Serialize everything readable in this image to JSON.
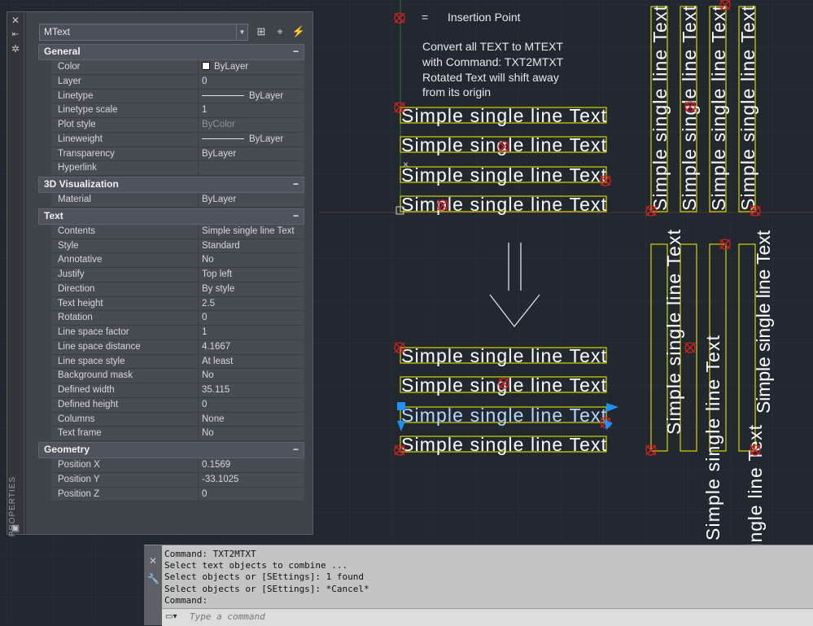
{
  "palette": {
    "close_icon": "close-icon",
    "vertical_title": "PROPERTIES",
    "object_type": "MText",
    "sections": [
      {
        "title": "General",
        "rows": [
          {
            "name": "Color",
            "value": "ByLayer",
            "icon": "swatch"
          },
          {
            "name": "Layer",
            "value": "0"
          },
          {
            "name": "Linetype",
            "value": "ByLayer",
            "icon": "line"
          },
          {
            "name": "Linetype scale",
            "value": "1"
          },
          {
            "name": "Plot style",
            "value": "ByColor",
            "dim": true
          },
          {
            "name": "Lineweight",
            "value": "ByLayer",
            "icon": "line"
          },
          {
            "name": "Transparency",
            "value": "ByLayer"
          },
          {
            "name": "Hyperlink",
            "value": ""
          }
        ]
      },
      {
        "title": "3D Visualization",
        "rows": [
          {
            "name": "Material",
            "value": "ByLayer"
          }
        ]
      },
      {
        "title": "Text",
        "rows": [
          {
            "name": "Contents",
            "value": "Simple single line Text"
          },
          {
            "name": "Style",
            "value": "Standard"
          },
          {
            "name": "Annotative",
            "value": "No"
          },
          {
            "name": "Justify",
            "value": "Top left"
          },
          {
            "name": "Direction",
            "value": "By style"
          },
          {
            "name": "Text height",
            "value": "2.5"
          },
          {
            "name": "Rotation",
            "value": "0"
          },
          {
            "name": "Line space factor",
            "value": "1"
          },
          {
            "name": "Line space distance",
            "value": "4.1667"
          },
          {
            "name": "Line space style",
            "value": "At least"
          },
          {
            "name": "Background mask",
            "value": "No"
          },
          {
            "name": "Defined width",
            "value": "35.115"
          },
          {
            "name": "Defined height",
            "value": "0"
          },
          {
            "name": "Columns",
            "value": "None"
          },
          {
            "name": "Text frame",
            "value": "No"
          }
        ]
      },
      {
        "title": "Geometry",
        "rows": [
          {
            "name": "Position X",
            "value": "0.1569"
          },
          {
            "name": "Position Y",
            "value": "-33.1025"
          },
          {
            "name": "Position Z",
            "value": "0"
          }
        ]
      }
    ],
    "collapse_symbol": "−"
  },
  "drawing": {
    "legend_equals": "=",
    "legend_label": "Insertion Point",
    "note_lines": [
      "Convert all TEXT to MTEXT",
      "with Command: TXT2MTXT",
      "Rotated Text will shift away",
      "from its origin"
    ],
    "sample_text": "Simple single line Text",
    "colors": {
      "background": "#212830",
      "text_box": "#d4d400",
      "marker": "#d42020",
      "grip": "#1e90ff",
      "grid": "#2b333c"
    }
  },
  "command_line": {
    "history": [
      "Command: TXT2MTXT",
      "Select text objects to combine ...",
      "Select objects or [SEttings]: 1 found",
      "Select objects or [SEttings]: *Cancel*",
      "Command:"
    ],
    "placeholder": "Type a command"
  }
}
